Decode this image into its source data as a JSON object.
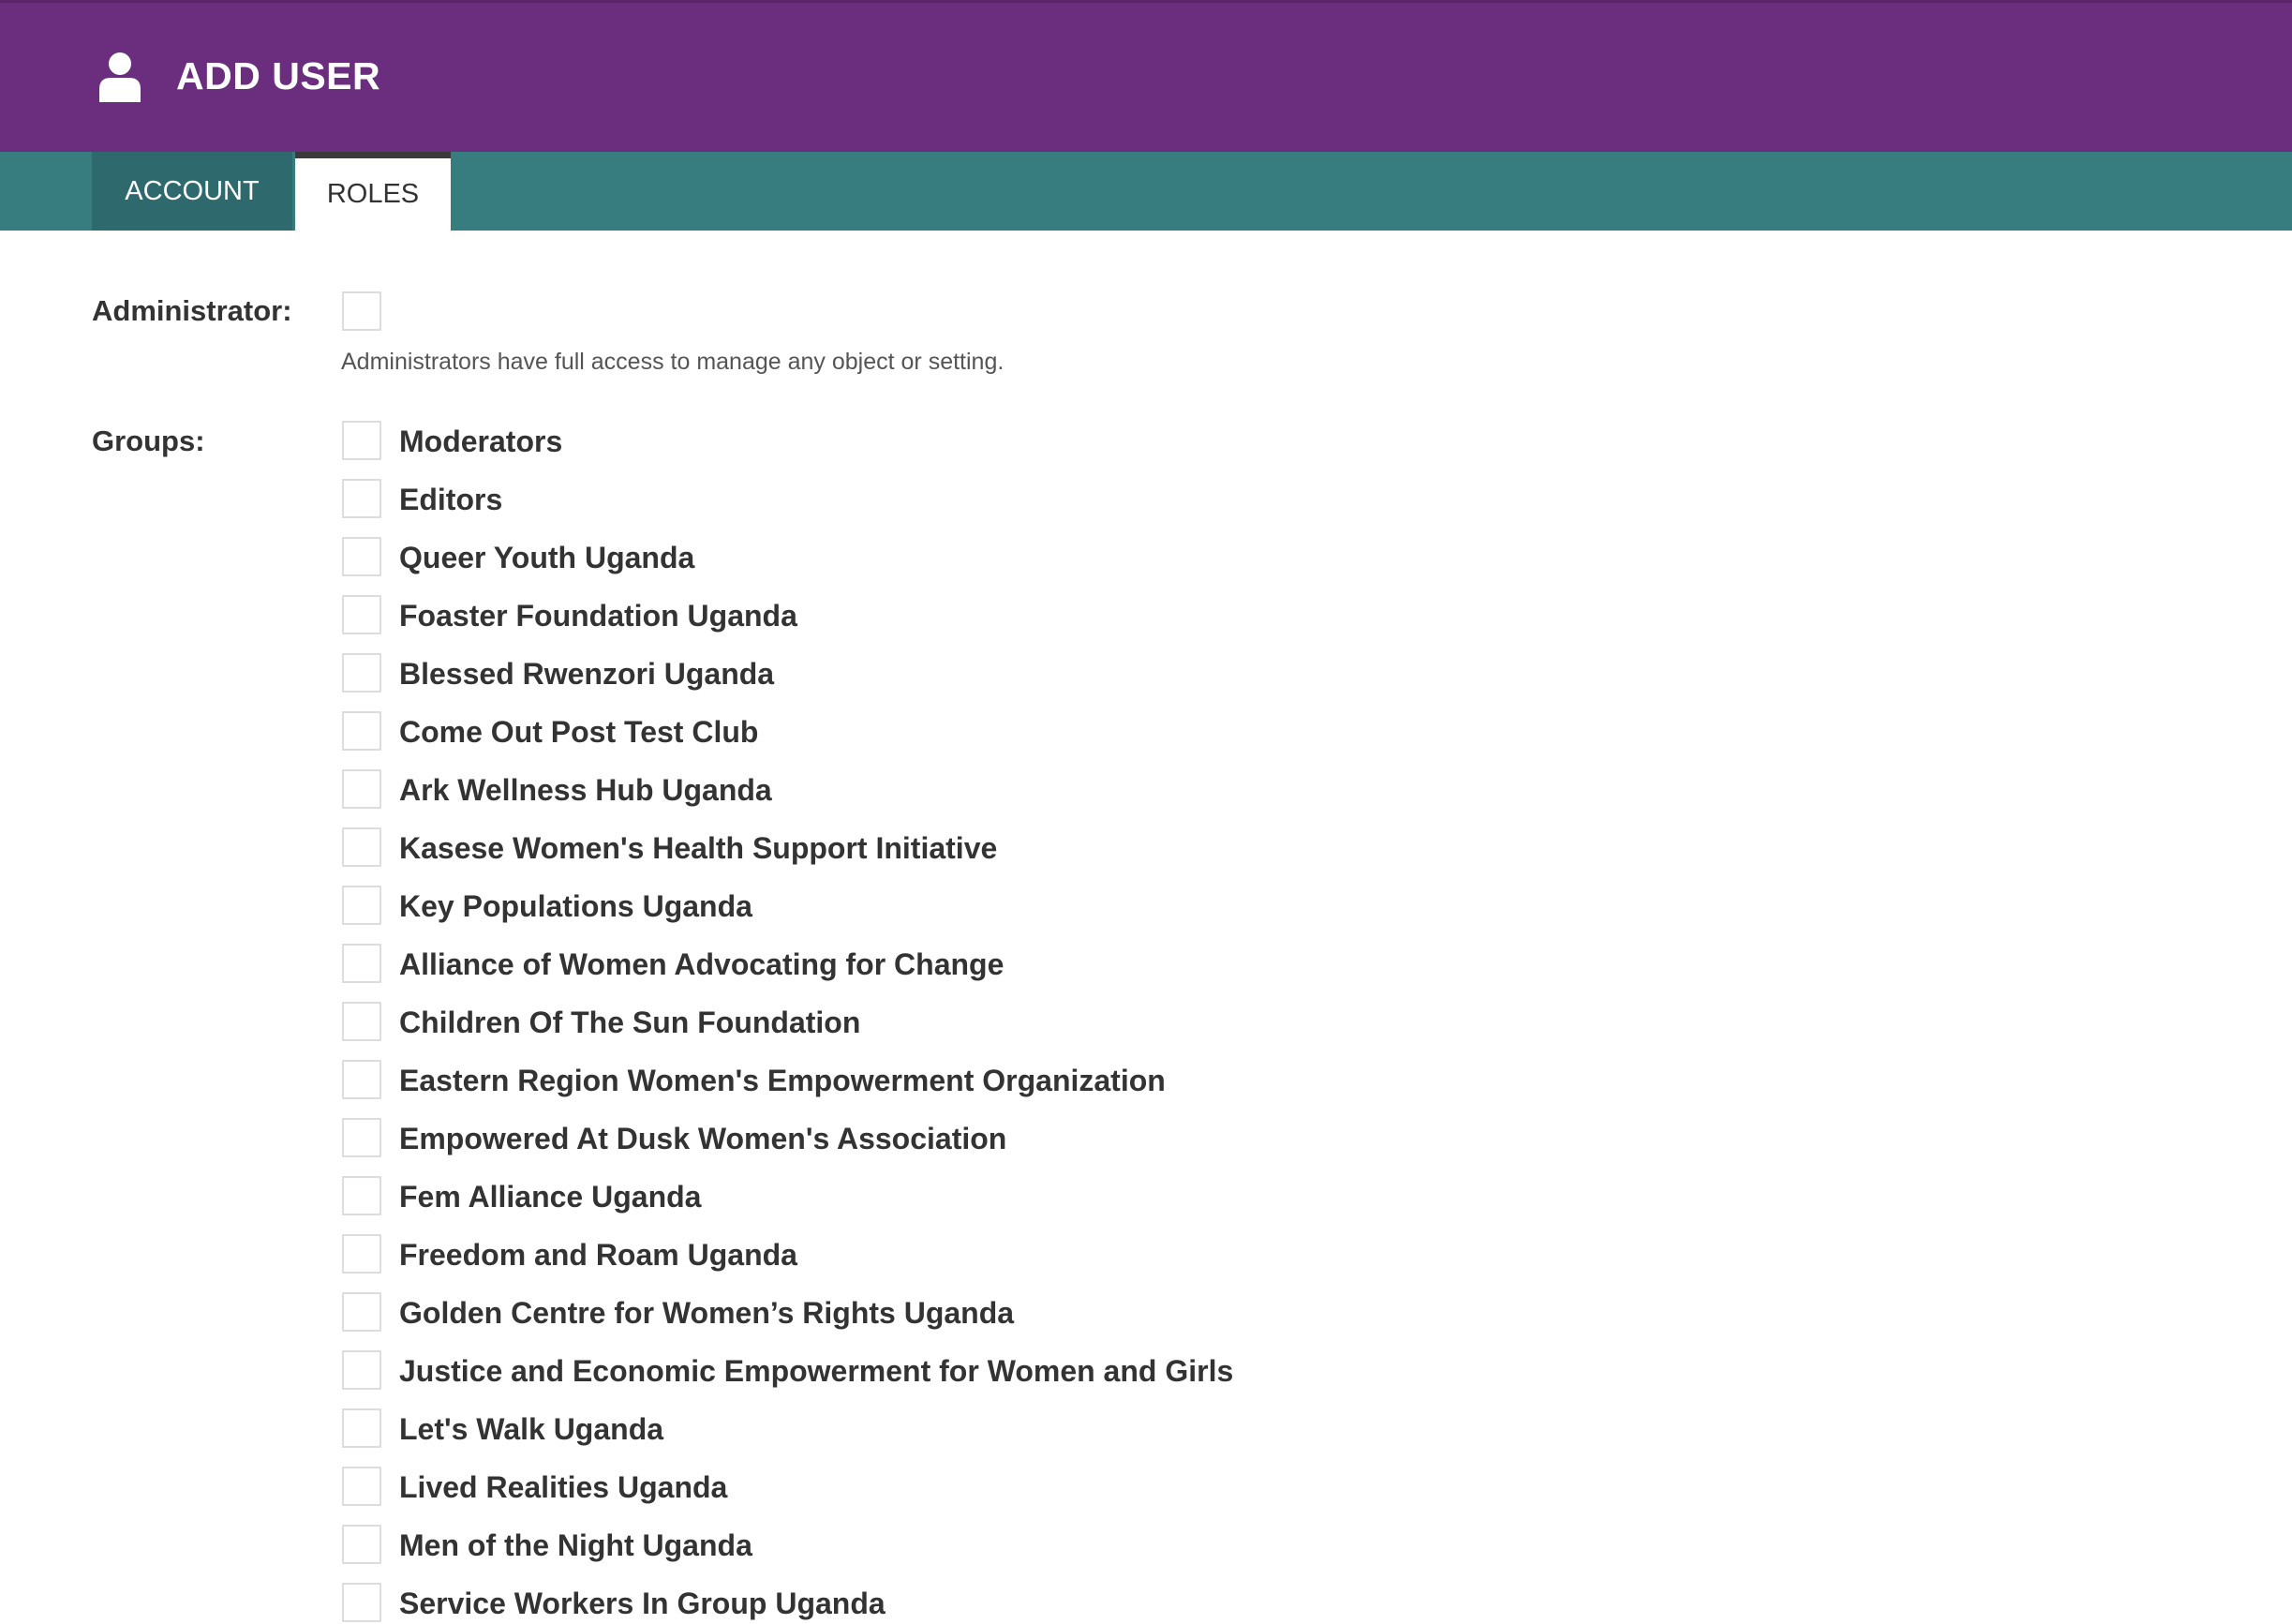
{
  "header": {
    "title": "ADD USER",
    "icon": "user-icon",
    "background": "#6b2d7e"
  },
  "tabs": [
    {
      "label": "ACCOUNT",
      "active": false
    },
    {
      "label": "ROLES",
      "active": true
    }
  ],
  "tab_bar_color": "#377c7f",
  "administrator": {
    "label": "Administrator:",
    "checked": false,
    "help": "Administrators have full access to manage any object or setting."
  },
  "groups": {
    "label": "Groups:",
    "items": [
      {
        "label": "Moderators",
        "checked": false
      },
      {
        "label": "Editors",
        "checked": false
      },
      {
        "label": "Queer Youth Uganda",
        "checked": false
      },
      {
        "label": "Foaster Foundation Uganda",
        "checked": false
      },
      {
        "label": "Blessed Rwenzori Uganda",
        "checked": false
      },
      {
        "label": "Come Out Post Test Club",
        "checked": false
      },
      {
        "label": "Ark Wellness Hub Uganda",
        "checked": false
      },
      {
        "label": "Kasese Women's Health Support Initiative",
        "checked": false
      },
      {
        "label": "Key Populations Uganda",
        "checked": false
      },
      {
        "label": "Alliance of Women Advocating for Change",
        "checked": false
      },
      {
        "label": "Children Of The Sun Foundation",
        "checked": false
      },
      {
        "label": "Eastern Region Women's Empowerment Organization",
        "checked": false
      },
      {
        "label": "Empowered At Dusk Women's Association",
        "checked": false
      },
      {
        "label": "Fem Alliance Uganda",
        "checked": false
      },
      {
        "label": "Freedom and Roam Uganda",
        "checked": false
      },
      {
        "label": "Golden Centre for Women’s Rights Uganda",
        "checked": false
      },
      {
        "label": "Justice and Economic Empowerment for Women and Girls",
        "checked": false
      },
      {
        "label": "Let's Walk Uganda",
        "checked": false
      },
      {
        "label": "Lived Realities Uganda",
        "checked": false
      },
      {
        "label": "Men of the Night Uganda",
        "checked": false
      },
      {
        "label": "Service Workers In Group Uganda",
        "checked": false
      }
    ]
  }
}
